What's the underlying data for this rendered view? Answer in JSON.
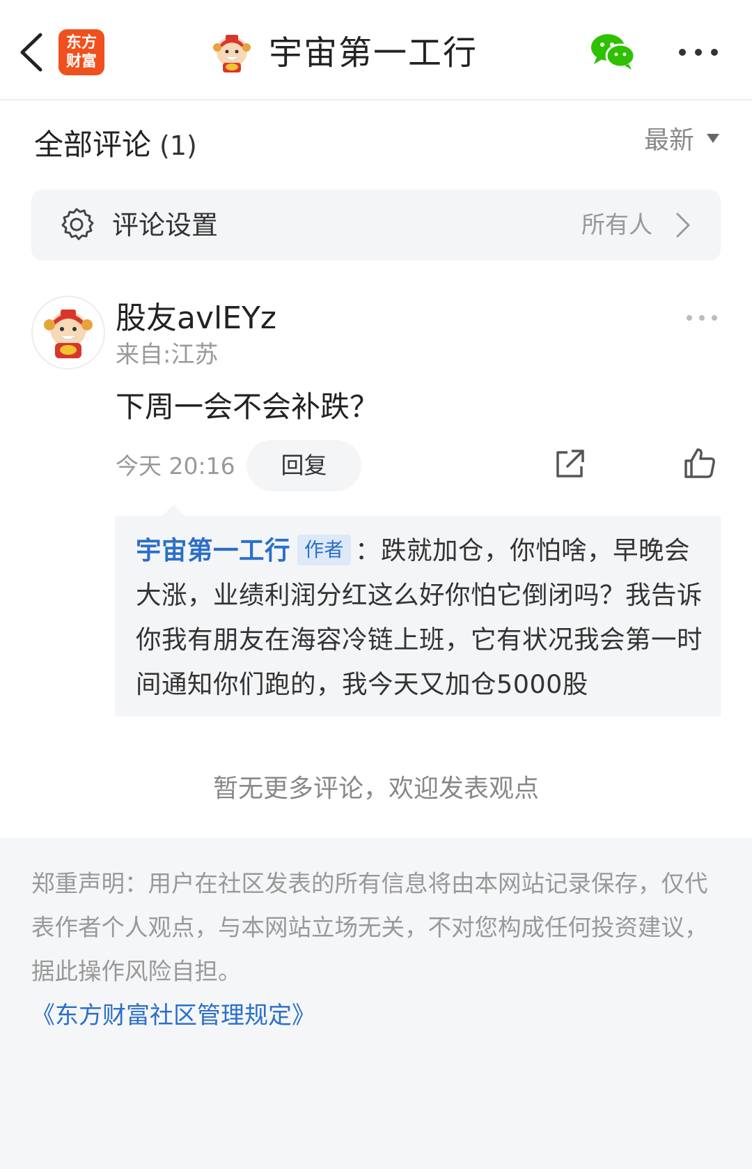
{
  "nav": {
    "back_icon": "chevron-left-icon",
    "brand_logo_text": "东方财富",
    "title": "宇宙第一工行",
    "share_wechat_icon": "wechat-icon",
    "more_icon": "more-horizontal-icon"
  },
  "comments_section": {
    "title": "全部评论",
    "count": "(1)",
    "sort_label": "最新"
  },
  "settings": {
    "label": "评论设置",
    "value": "所有人"
  },
  "comment": {
    "username": "股友avlEYz",
    "location": "来自:江苏",
    "text": "下周一会不会补跌？",
    "time": "今天 20:16",
    "reply_button": "回复"
  },
  "reply": {
    "author": "宇宙第一工行",
    "author_tag": "作者",
    "text": "：跌就加仓，你怕啥，早晚会大涨，业绩利润分红这么好你怕它倒闭吗？我告诉你我有朋友在海容冷链上班，它有状况我会第一时间通知你们跑的，我今天又加仓5000股"
  },
  "no_more_text": "暂无更多评论，欢迎发表观点",
  "footer": {
    "disclaimer": "郑重声明：用户在社区发表的所有信息将由本网站记录保存，仅代表作者个人观点，与本网站立场无关，不对您构成任何投资建议，据此操作风险自担。",
    "rules_link": "《东方财富社区管理规定》"
  },
  "colors": {
    "brand_orange": "#f0501e",
    "link_blue": "#2a6fc9",
    "wechat_green": "#2dc100"
  }
}
